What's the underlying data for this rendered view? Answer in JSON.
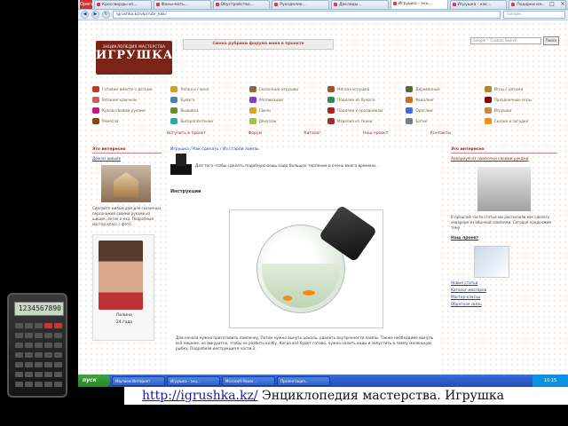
{
  "browser": {
    "opera_label": "Opera",
    "tabs": [
      {
        "label": "Кроссворды из..."
      },
      {
        "label": "Фоны-мать..."
      },
      {
        "label": "Обустройство..."
      },
      {
        "label": "Рукоделие..."
      },
      {
        "label": "Доклады..."
      },
      {
        "label": "Игрушка - энц...",
        "active": true
      },
      {
        "label": "Игрушка - как..."
      },
      {
        "label": "Подарки из..."
      },
      {
        "label": "Сделай сам..."
      }
    ],
    "url": "igrushka.kz/vip/rubr_kak/",
    "search_placeholder": "Google"
  },
  "page": {
    "logo_top": "ЭНЦИКЛОПЕДИЯ МАСТЕРСТВА",
    "logo_main": "ИГРУШКА",
    "banner": "Смена рубрики форума меня в проекте",
    "search_placeholder": "Google™ Custom Search",
    "search_button": "Поиск",
    "categories": [
      {
        "label": "Готовим вместе с детьми",
        "color": "#c0392b"
      },
      {
        "label": "Лепка и глина",
        "color": "#d4a017"
      },
      {
        "label": "Сказочные игрушки",
        "color": "#8e6c3a"
      },
      {
        "label": "Мягкая игрушка",
        "color": "#a0522d"
      },
      {
        "label": "Деревянные",
        "color": "#556b2f"
      },
      {
        "label": "Игры с детьми",
        "color": "#b8860b"
      },
      {
        "label": "Вязание крючком",
        "color": "#cd5c5c"
      },
      {
        "label": "Бумага",
        "color": "#4682b4"
      },
      {
        "label": "Аппликации",
        "color": "#9932cc"
      },
      {
        "label": "Поделки из бумаги",
        "color": "#2e8b57"
      },
      {
        "label": "Квиллинг",
        "color": "#d2691e"
      },
      {
        "label": "Праздничные игры",
        "color": "#8b0000"
      },
      {
        "label": "Куклы своими руками",
        "color": "#c71585"
      },
      {
        "label": "Вышивка",
        "color": "#6b8e23"
      },
      {
        "label": "Свечи",
        "color": "#daa520"
      },
      {
        "label": "Поделки к праздникам",
        "color": "#b22222"
      },
      {
        "label": "Оригами",
        "color": "#4169e1"
      },
      {
        "label": "Игрушки",
        "color": "#cd853f"
      },
      {
        "label": "Ремёсла",
        "color": "#8b4513"
      },
      {
        "label": "Бисероплетение",
        "color": "#20b2aa"
      },
      {
        "label": "Декупаж",
        "color": "#9acd32"
      },
      {
        "label": "Изделия из ткани",
        "color": "#a52a2a"
      },
      {
        "label": "Батик",
        "color": "#708090"
      },
      {
        "label": "Сказки и загадки",
        "color": "#ff8c00"
      }
    ],
    "subnav": [
      "Вступить в проект",
      "Форум",
      "Каталог",
      "Наш проект",
      "Контакты"
    ],
    "left": {
      "heading": "Это интересно",
      "link": "Дом из шишек",
      "text": "Сделайте милый дом для сказочных персонажей своими руками из шишек, веток и мха. Подробный мастер-класс с фото.",
      "ad_name": "Полина",
      "ad_age": "24 года"
    },
    "center": {
      "breadcrumb": "Игрушка / Как сделать / Из старой лампы",
      "intro": "Для того чтобы сделать подобную вещь надо большое терпение и очень много времени...",
      "section_title": "Инструкции",
      "caption": "Для начала нужно приготовить лампочку. Потом нужно вынуть цоколь, удалить внутренности лампы. Также необходимо вынуть всё лишнее, но аккуратно, чтобы не разбить колбу. Когда всё будет готово, нужно налить воды и запустить в лампу маленькую рыбку. Подробная инструкция в части 2."
    },
    "right": {
      "heading": "Это интересно",
      "link": "Аквариум из лампочки своими руками",
      "text": "В прошлой части статьи мы рассказали как сделать аквариум из обычной лампочки. Сегодня продолжим тему.",
      "heading2": "Наш проект",
      "links": [
        "Новые статьи",
        "Каталог мастеров",
        "Мастер-классы",
        "Обратная связь"
      ]
    }
  },
  "taskbar": {
    "start": "пуск",
    "tasks": [
      "Изучаем Интернет",
      "Игрушка - энц...",
      "Microsoft Power...",
      "Презентация..."
    ],
    "clock": "10:15"
  },
  "calculator": {
    "display": "1234567890"
  },
  "slide_caption": {
    "link": "http://igrushka.kz/",
    "text": " Энциклопедия мастерства. Игрушка"
  }
}
